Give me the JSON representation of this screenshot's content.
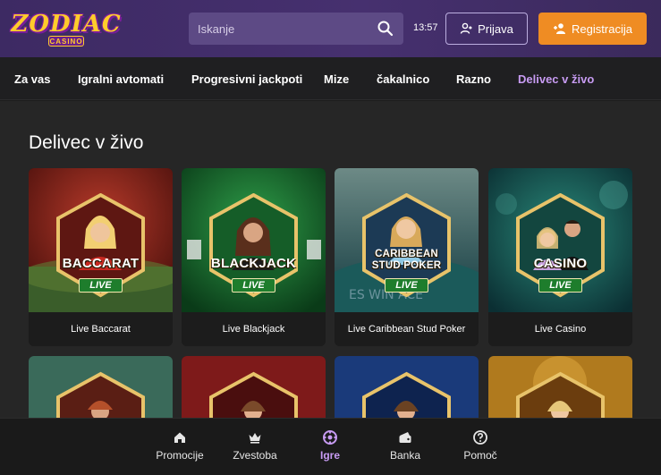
{
  "header": {
    "logo_text": "ZODIAC",
    "logo_subtext": "CASINO",
    "search_placeholder": "Iskanje",
    "clock": "13:57",
    "login_label": "Prijava",
    "register_label": "Registracija"
  },
  "nav": {
    "items": [
      {
        "label": "Za vas"
      },
      {
        "label": "Igralni avtomati"
      },
      {
        "label": "Progresivni jackpoti"
      },
      {
        "label": "Mize"
      },
      {
        "label": "čakalnico"
      },
      {
        "label": "Razno"
      },
      {
        "label": "Delivec v živo",
        "active": true
      }
    ]
  },
  "main": {
    "title": "Delivec v živo",
    "cards": [
      {
        "title": "Live Baccarat",
        "badge_text": "BACCARAT",
        "live": "LIVE"
      },
      {
        "title": "Live Blackjack",
        "badge_text": "BLACKJACK",
        "live": "LIVE"
      },
      {
        "title": "Live Caribbean Stud Poker",
        "badge_line1": "CARIBBEAN",
        "badge_line2": "STUD POKER",
        "live": "LIVE"
      },
      {
        "title": "Live Casino",
        "badge_text": "CASINO",
        "live": "LIVE"
      }
    ]
  },
  "bottom_nav": {
    "tabs": [
      {
        "label": "Promocije",
        "icon": "home-icon"
      },
      {
        "label": "Zvestoba",
        "icon": "crown-icon"
      },
      {
        "label": "Igre",
        "icon": "games-icon",
        "active": true
      },
      {
        "label": "Banka",
        "icon": "wallet-icon"
      },
      {
        "label": "Pomoč",
        "icon": "help-icon"
      }
    ]
  },
  "colors": {
    "header_bg": "#46306f",
    "accent_purple": "#c79bf2",
    "register_orange": "#ef8c23",
    "live_green": "#1e7d2c"
  }
}
